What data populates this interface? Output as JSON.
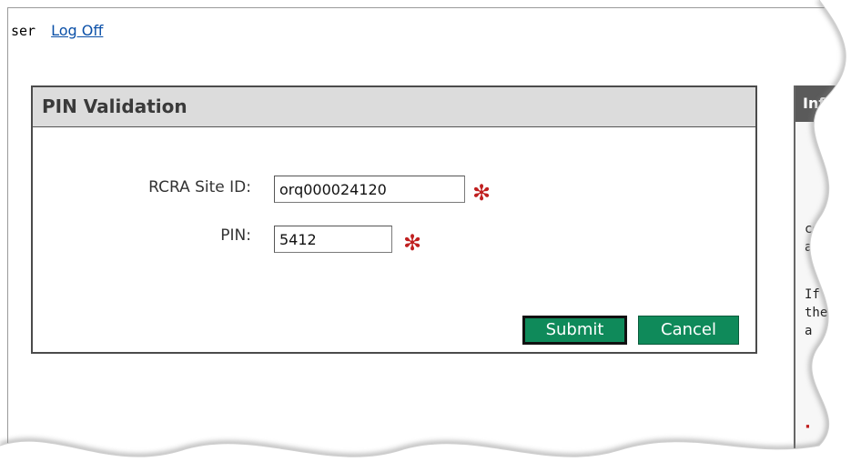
{
  "header": {
    "user_text": "ser",
    "logoff_label": "Log Off"
  },
  "dialog": {
    "title": "PIN Validation",
    "site_id_label": "RCRA Site ID:",
    "site_id_value": "orq000024120",
    "pin_label": "PIN:",
    "pin_value": "5412",
    "required_marker": "✻",
    "submit_label": "Submit",
    "cancel_label": "Cancel"
  },
  "side_panel": {
    "title_fragment": "Inf",
    "text_lines": [
      "co",
      "a us",
      "If yo",
      "the",
      "a"
    ],
    "red_marker": "·"
  },
  "colors": {
    "button_green": "#0f8a5a",
    "required_red": "#c02020",
    "link_blue": "#0b50a8",
    "panel_header": "#dcdcdc"
  }
}
